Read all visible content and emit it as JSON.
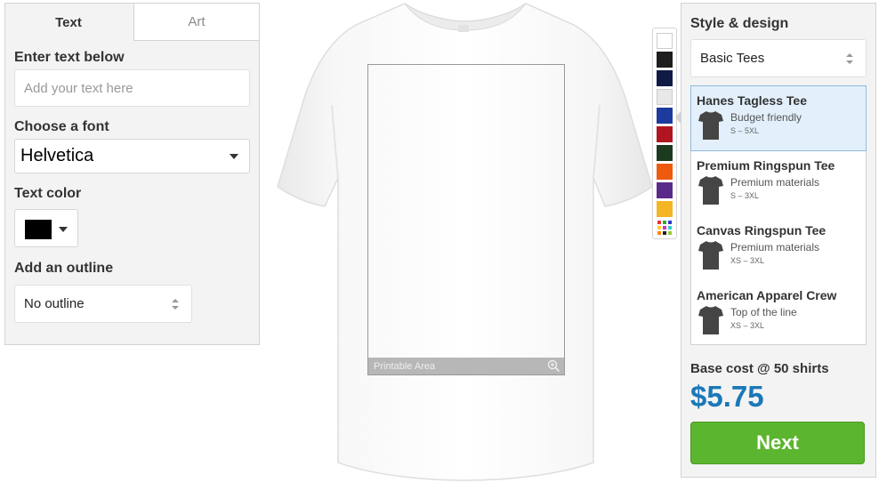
{
  "tabs": {
    "text": "Text",
    "art": "Art"
  },
  "text_section": {
    "label": "Enter text below",
    "placeholder": "Add your text here"
  },
  "font_section": {
    "label": "Choose a font",
    "selected": "Helvetica"
  },
  "color_section": {
    "label": "Text color",
    "selected_color": "#000000"
  },
  "outline_section": {
    "label": "Add an outline",
    "selected": "No outline"
  },
  "canvas": {
    "printable_label": "Printable Area",
    "zoom_icon": "zoom-in-icon"
  },
  "shirt_colors": [
    "#ffffff",
    "#1e1e1e",
    "#0f1a45",
    "#e8e8e8",
    "#1d3a9e",
    "#b01520",
    "#1c3a1e",
    "#ee5a0e",
    "#5a2a8a",
    "#f4b624",
    "multicolor"
  ],
  "style": {
    "title": "Style & design",
    "selected_category": "Basic Tees",
    "products": [
      {
        "name": "Hanes Tagless Tee",
        "desc": "Budget friendly",
        "sizes": "S – 5XL",
        "selected": true
      },
      {
        "name": "Premium Ringspun Tee",
        "desc": "Premium materials",
        "sizes": "S – 3XL",
        "selected": false
      },
      {
        "name": "Canvas Ringspun Tee",
        "desc": "Premium materials",
        "sizes": "XS – 3XL",
        "selected": false
      },
      {
        "name": "American Apparel Crew",
        "desc": "Top of the line",
        "sizes": "XS – 3XL",
        "selected": false
      }
    ]
  },
  "pricing": {
    "label": "Base cost @ 50 shirts",
    "price": "$5.75"
  },
  "next_label": "Next"
}
